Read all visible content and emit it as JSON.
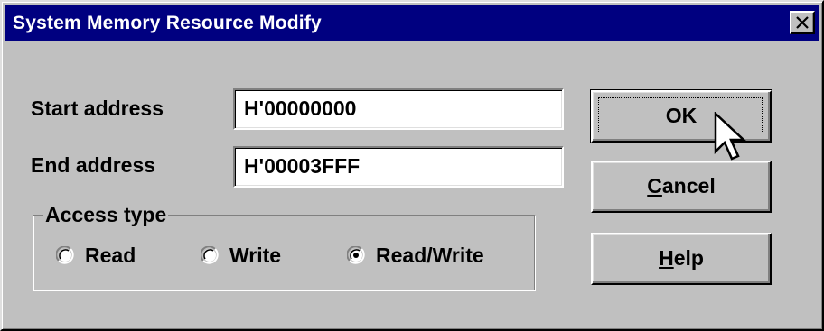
{
  "window": {
    "title": "System Memory Resource Modify",
    "close_glyph": "✕"
  },
  "form": {
    "start_address": {
      "label": "Start address",
      "value": "H'00000000"
    },
    "end_address": {
      "label": "End address",
      "value": "H'00003FFF"
    }
  },
  "access_type": {
    "legend": "Access type",
    "options": [
      {
        "label": "Read",
        "selected": false
      },
      {
        "label": "Write",
        "selected": false
      },
      {
        "label": "Read/Write",
        "selected": true
      }
    ]
  },
  "buttons": {
    "ok": {
      "label": "OK"
    },
    "cancel": {
      "mnemonic": "C",
      "rest": "ancel"
    },
    "help": {
      "mnemonic": "H",
      "rest": "elp"
    }
  },
  "colors": {
    "face": "#c0c0c0",
    "titlebar": "#000080",
    "title_text": "#ffffff"
  }
}
